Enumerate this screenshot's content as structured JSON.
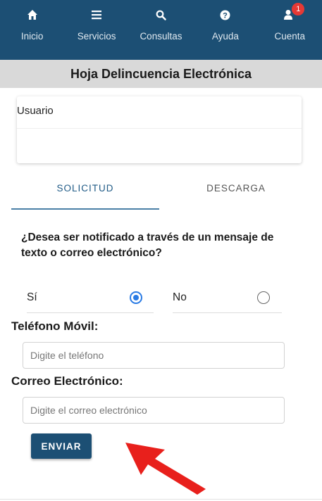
{
  "nav": {
    "items": [
      {
        "label": "Inicio",
        "icon": "home-icon"
      },
      {
        "label": "Servicios",
        "icon": "menu-icon"
      },
      {
        "label": "Consultas",
        "icon": "search-icon"
      },
      {
        "label": "Ayuda",
        "icon": "help-icon"
      },
      {
        "label": "Cuenta",
        "icon": "user-icon",
        "badge": "1"
      }
    ]
  },
  "page": {
    "title": "Hoja Delincuencia Electrónica"
  },
  "user_card": {
    "label": "Usuario"
  },
  "tabs": [
    {
      "label": "SOLICITUD",
      "active": true
    },
    {
      "label": "DESCARGA",
      "active": false
    }
  ],
  "form": {
    "question": "¿Desea ser notificado a través de un mensaje de texto o correo electrónico?",
    "yes_label": "Sí",
    "no_label": "No",
    "selected": "yes",
    "phone_label": "Teléfono Móvil:",
    "phone_placeholder": "Digite el teléfono",
    "email_label": "Correo Electrónico:",
    "email_placeholder": "Digite el correo electrónico",
    "submit_label": "ENVIAR"
  },
  "colors": {
    "brand": "#1c4f74",
    "radio_accent": "#2a7be4",
    "badge": "#e53935",
    "arrow": "#e8201c"
  }
}
